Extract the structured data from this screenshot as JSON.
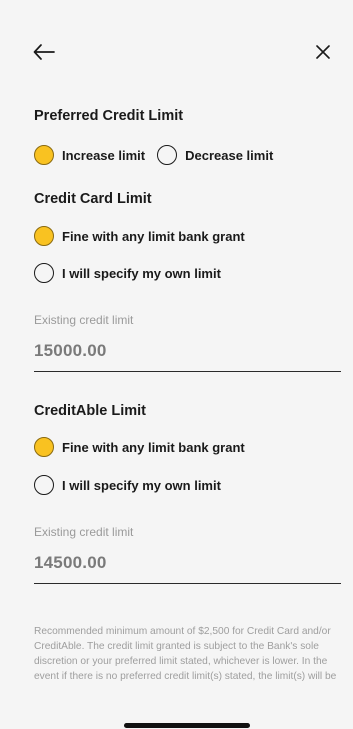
{
  "preferred_credit_limit": {
    "title": "Preferred Credit Limit",
    "options": [
      {
        "label": "Increase limit",
        "selected": true
      },
      {
        "label": "Decrease limit",
        "selected": false
      }
    ]
  },
  "credit_card_limit": {
    "title": "Credit Card Limit",
    "options": [
      {
        "label": "Fine with any limit bank grant",
        "selected": true
      },
      {
        "label": "I will specify my own limit",
        "selected": false
      }
    ],
    "existing_label": "Existing credit limit",
    "existing_value": "15000.00"
  },
  "creditable_limit": {
    "title": "CreditAble Limit",
    "options": [
      {
        "label": "Fine with any limit bank grant",
        "selected": true
      },
      {
        "label": "I will specify my own limit",
        "selected": false
      }
    ],
    "existing_label": "Existing credit limit",
    "existing_value": "14500.00"
  },
  "note": "Recommended minimum amount of $2,500 for Credit Card and/or CreditAble. The credit limit granted is subject to the Bank's sole discretion or your preferred limit stated, whichever is lower. In the event if there is no preferred credit limit(s) stated, the limit(s) will be",
  "icons": {
    "back": "arrow-left-icon",
    "close": "close-icon"
  },
  "colors": {
    "radio_selected": "#f9c221",
    "text": "#1a1a1a",
    "muted": "#9a9a9a"
  }
}
